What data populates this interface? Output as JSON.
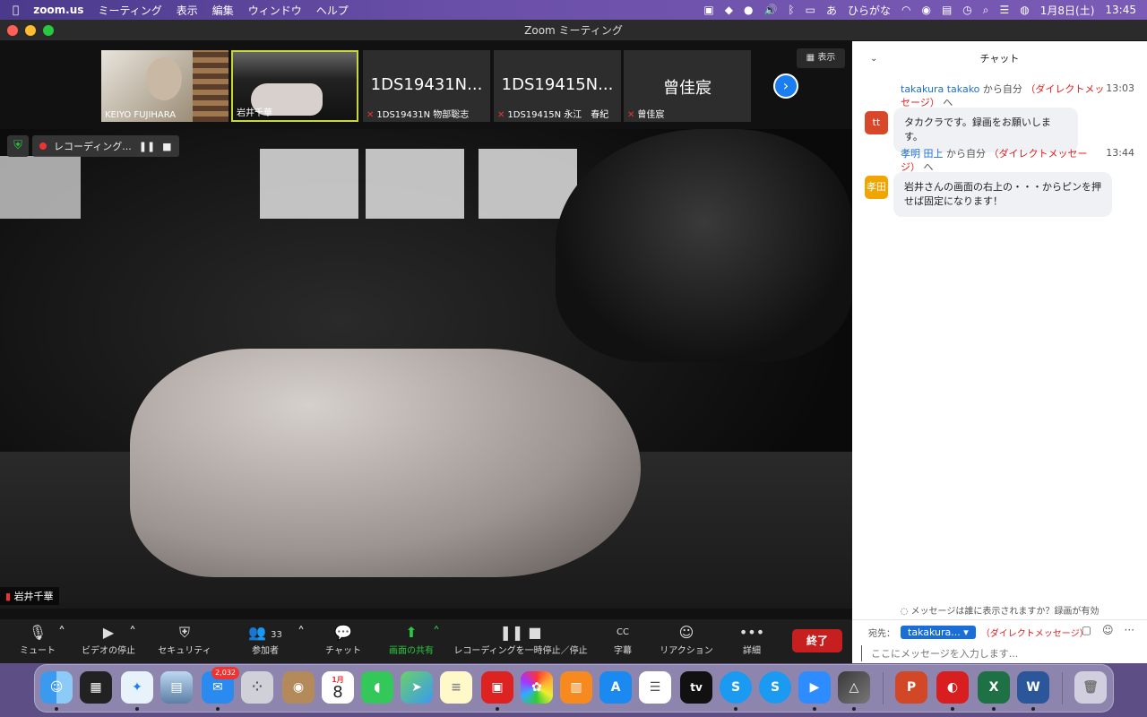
{
  "menubar": {
    "app": "zoom.us",
    "items": [
      "ミーティング",
      "表示",
      "編集",
      "ウィンドウ",
      "ヘルプ"
    ],
    "ime": "ひらがな",
    "date": "1月8日(土)",
    "time": "13:45"
  },
  "window": {
    "title": "Zoom ミーティング"
  },
  "stage": {
    "view_label": "表示",
    "thumbnails": [
      {
        "name": "KEIYO FUJIHARA",
        "big": "",
        "muted": false
      },
      {
        "name": "岩井千華",
        "big": "",
        "muted": false
      },
      {
        "name": "1DS19431N 物部聡志",
        "big": "1DS19431N...",
        "muted": true
      },
      {
        "name": "1DS19415N 永江　春紀",
        "big": "1DS19415N...",
        "muted": true
      },
      {
        "name": "曾佳宸",
        "big": "曾佳宸",
        "muted": true
      }
    ],
    "recording_label": "レコーディング...",
    "main_speaker": "岩井千華"
  },
  "toolbar": {
    "mute": "ミュート",
    "video": "ビデオの停止",
    "security": "セキュリティ",
    "participants": "参加者",
    "participants_count": "33",
    "chat": "チャット",
    "share": "画面の共有",
    "recording": "レコーディングを一時停止／停止",
    "captions": "字幕",
    "captions_icon": "CC",
    "reactions": "リアクション",
    "more": "詳細",
    "end": "終了"
  },
  "chat": {
    "title": "チャット",
    "messages": [
      {
        "sender": "takakura takako",
        "to": "から自分",
        "dm": "（ダイレクトメッセージ）",
        "time": "13:03",
        "avatar": "tt",
        "avatar_color": "#d9472b",
        "text": "タカクラです。録画をお願いします。"
      },
      {
        "sender": "孝明 田上",
        "to": "から自分",
        "dm": "（ダイレクトメッセージ）",
        "time": "13:44",
        "avatar": "孝田",
        "avatar_color": "#f0a500",
        "text": "岩井さんの画面の右上の・・・からピンを押せば固定になります！"
      }
    ],
    "notice": "メッセージは誰に表示されますか？録画が有効",
    "to_label": "宛先：",
    "to_value": "takakura...",
    "to_dm": "（ダイレクトメッセージ）",
    "placeholder": "ここにメッセージを入力します..."
  },
  "dock": {
    "mail_badge": "2,032",
    "calendar_month": "1月",
    "calendar_day": "8",
    "tv_label": "tv"
  }
}
